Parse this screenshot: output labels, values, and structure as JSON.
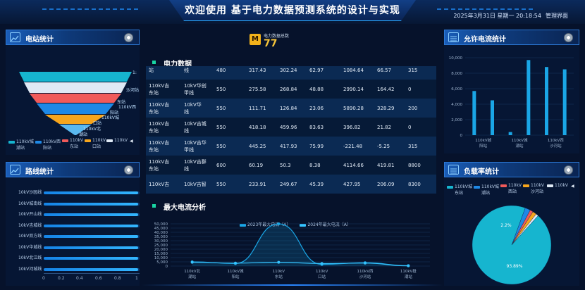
{
  "header": {
    "title": "欢迎使用 基于电力数据预测系统的设计与实现",
    "datetime": "2025年3月31日 星期一 20:18:54",
    "mgmt_label": "管理界面"
  },
  "station_stats": {
    "title": "电站统计",
    "funnel_labels": [
      "1:",
      "沙河站",
      "东站",
      "110kV西",
      "阳站",
      "110kV城",
      "口站",
      "110kV北",
      "潮站"
    ],
    "funnel_colors": [
      "#16b5cf",
      "#dfe9f5",
      "#f05a5a",
      "#1e88e5",
      "#f6a51c",
      "#5ab8ef"
    ],
    "legend": [
      {
        "label": "110kV城",
        "sub": "潮站",
        "color": "#16b5cf"
      },
      {
        "label": "110kV西",
        "sub": "阳站",
        "color": "#1e88e5"
      },
      {
        "label": "110kV",
        "sub": "东站",
        "color": "#f05a5a"
      },
      {
        "label": "110kV",
        "sub": "口站",
        "color": "#f6a51c"
      },
      {
        "label": "110kV",
        "sub": "",
        "color": "#dfe9f5"
      }
    ]
  },
  "line_stats": {
    "title": "路线统计",
    "rows": [
      {
        "label": "10kV沙园线",
        "value": 1.0
      },
      {
        "label": "10kV城南线",
        "value": 1.0
      },
      {
        "label": "10kV开山线",
        "value": 1.0
      },
      {
        "label": "10kV吉城线",
        "value": 1.0
      },
      {
        "label": "10kV双方线",
        "value": 1.0
      },
      {
        "label": "10kV华城线",
        "value": 1.0
      },
      {
        "label": "10kV北江线",
        "value": 1.0
      },
      {
        "label": "10kV河城线",
        "value": 1.0
      }
    ],
    "ticks": [
      "0",
      "0.2",
      "0.4",
      "0.6",
      "0.8",
      "1"
    ]
  },
  "counter": {
    "label": "电力数据总数",
    "value": "77"
  },
  "power_data": {
    "title": "电力数据",
    "rows": [
      [
        "站",
        "线",
        "480",
        "317.43",
        "302.24",
        "62.97",
        "1084.64",
        "66.57",
        "315"
      ],
      [
        "110kV吉 东站",
        "10kV华创 甲线",
        "550",
        "275.58",
        "268.84",
        "48.88",
        "2990.14",
        "164.42",
        "0"
      ],
      [
        "110kV吉 东站",
        "10kV华 线",
        "550",
        "111.71",
        "126.84",
        "23.06",
        "5890.28",
        "328.29",
        "200"
      ],
      [
        "110kV吉 东站",
        "10kV吉城 线",
        "550",
        "418.18",
        "459.96",
        "83.63",
        "396.82",
        "21.82",
        "0"
      ],
      [
        "110kV吉 东站",
        "10kV吉华 甲线",
        "550",
        "445.25",
        "417.93",
        "75.99",
        "-221.48",
        "-5.25",
        "315"
      ],
      [
        "110kV吉 东站",
        "10kV吉群 线",
        "600",
        "60.19",
        "50.3",
        "8.38",
        "4114.66",
        "419.81",
        "8800"
      ],
      [
        "110kV吉",
        "10kV吉智",
        "550",
        "233.91",
        "249.67",
        "45.39",
        "427.95",
        "206.09",
        "8300"
      ]
    ]
  },
  "max_current": {
    "title": "最大电流分析",
    "legend": [
      "2023年最大电流（A）",
      "2024年最大电流（A）"
    ]
  },
  "allowed_current": {
    "title": "允许电流统计"
  },
  "load_rate": {
    "title": "负载率统计",
    "legend": [
      {
        "label": "110kV城",
        "sub": "东站",
        "color": "#16b5cf"
      },
      {
        "label": "110kV城",
        "sub": "潮站",
        "color": "#1e88e5"
      },
      {
        "label": "110kV",
        "sub": "西站",
        "color": "#f05a5a"
      },
      {
        "label": "110kV",
        "sub": "沙河站",
        "color": "#f6a51c"
      },
      {
        "label": "110kV",
        "sub": "",
        "color": "#dfe9f5"
      }
    ],
    "labels": [
      "2.2%",
      "93.89%"
    ]
  },
  "chart_data": [
    {
      "type": "line",
      "title": "最大电流分析",
      "categories": [
        "110kV北 潮站",
        "110kV城 阳站",
        "110kV 东站",
        "110kV 口站",
        "110kV西 沙河站",
        "110kV投 潮站"
      ],
      "series": [
        {
          "name": "2023年最大电流（A）",
          "values": [
            5000,
            3000,
            50000,
            2000,
            4000,
            500
          ],
          "color": "#1aa6e6"
        },
        {
          "name": "2024年最大电流（A）",
          "values": [
            4500,
            3500,
            4500,
            3000,
            3500,
            300
          ],
          "color": "#35c4ff"
        }
      ],
      "y_ticks": [
        "0",
        "5,000",
        "10,000",
        "15,000",
        "20,000",
        "25,000",
        "30,000",
        "35,000",
        "40,000",
        "45,000",
        "50,000"
      ],
      "ylim": [
        0,
        50000
      ],
      "legend_position": "top"
    },
    {
      "type": "bar",
      "title": "允许电流统计",
      "categories": [
        "110kV城 阳站",
        "110kV城 潮站",
        "110kV 潮站",
        "110kV北",
        "110kV西 沙河站",
        "110kV"
      ],
      "values": [
        5700,
        4500,
        400,
        9700,
        8800,
        8500
      ],
      "y_ticks": [
        "0",
        "2,000",
        "4,000",
        "6,000",
        "8,000",
        "10,000"
      ],
      "ylim": [
        0,
        10000
      ]
    },
    {
      "type": "pie",
      "title": "负载率统计",
      "slices": [
        {
          "label": "110kV城 东站",
          "value": 93.89,
          "color": "#16b5cf"
        },
        {
          "label": "110kV城 潮站",
          "value": 2.2,
          "color": "#1e88e5"
        },
        {
          "label": "110kV 西站",
          "value": 1.3,
          "color": "#f05a5a"
        },
        {
          "label": "110kV 沙河站",
          "value": 1.6,
          "color": "#f6a51c"
        },
        {
          "label": "110kV",
          "value": 1.01,
          "color": "#dfe9f5"
        }
      ],
      "labels_shown": [
        "2.2%",
        "93.89%"
      ]
    }
  ]
}
